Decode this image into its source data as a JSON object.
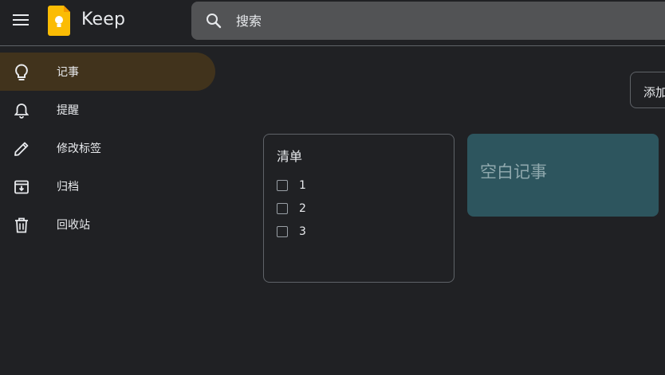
{
  "header": {
    "app_title": "Keep",
    "search_placeholder": "搜索"
  },
  "sidebar": {
    "items": [
      {
        "label": "记事",
        "icon": "lightbulb-icon",
        "active": true
      },
      {
        "label": "提醒",
        "icon": "bell-icon",
        "active": false
      },
      {
        "label": "修改标签",
        "icon": "pencil-icon",
        "active": false
      },
      {
        "label": "归档",
        "icon": "archive-icon",
        "active": false
      },
      {
        "label": "回收站",
        "icon": "trash-icon",
        "active": false
      }
    ]
  },
  "main": {
    "add_button_label": "添加",
    "notes": [
      {
        "type": "checklist",
        "title": "清单",
        "items": [
          {
            "text": "1",
            "checked": false
          },
          {
            "text": "2",
            "checked": false
          },
          {
            "text": "3",
            "checked": false
          }
        ]
      },
      {
        "type": "text",
        "placeholder_text": "空白记事",
        "color": "#2d555e"
      }
    ]
  },
  "colors": {
    "background": "#202124",
    "active_nav": "#41331c",
    "search_bg": "#525355",
    "logo_yellow": "#fbbc04"
  }
}
